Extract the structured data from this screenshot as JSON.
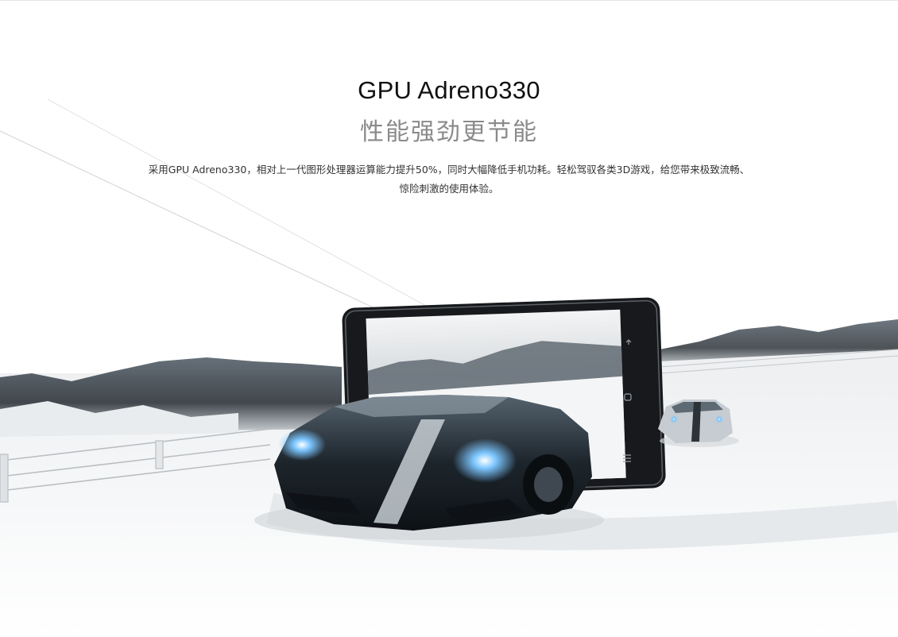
{
  "hero": {
    "title": "GPU Adreno330",
    "subtitle": "性能强劲更节能",
    "description": "采用GPU Adreno330，相对上一代图形处理器运算能力提升50%，同时大幅降低手机功耗。轻松驾驭各类3D游戏，给您带来极致流畅、惊险刺激的使用体验。"
  },
  "colors": {
    "title": "#111111",
    "subtitle": "#8a8a8a",
    "snow": "#f4f5f6",
    "mountain": "#3b4147",
    "phone_frame": "#1c1f22",
    "car_body": "#232b32",
    "headlight": "#3fa8ff"
  },
  "icons": {
    "phone_back": "back-icon",
    "phone_home": "home-icon",
    "phone_menu": "menu-icon"
  }
}
